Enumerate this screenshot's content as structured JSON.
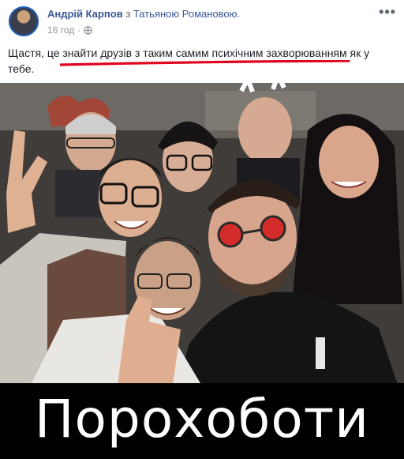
{
  "post": {
    "author": "Андрій Карпов",
    "with_word": "з",
    "tagged": "Татьяною Романовою.",
    "time": "16 год",
    "dot": "·",
    "more_icon": "more-horizontal-icon",
    "privacy_icon": "globe-icon",
    "text": "Щастя, це знайти друзів з таким самим психічним захворюванням як у тебе.",
    "underline_color": "#e0001b"
  },
  "photo": {
    "caption": "Порохоботи"
  }
}
